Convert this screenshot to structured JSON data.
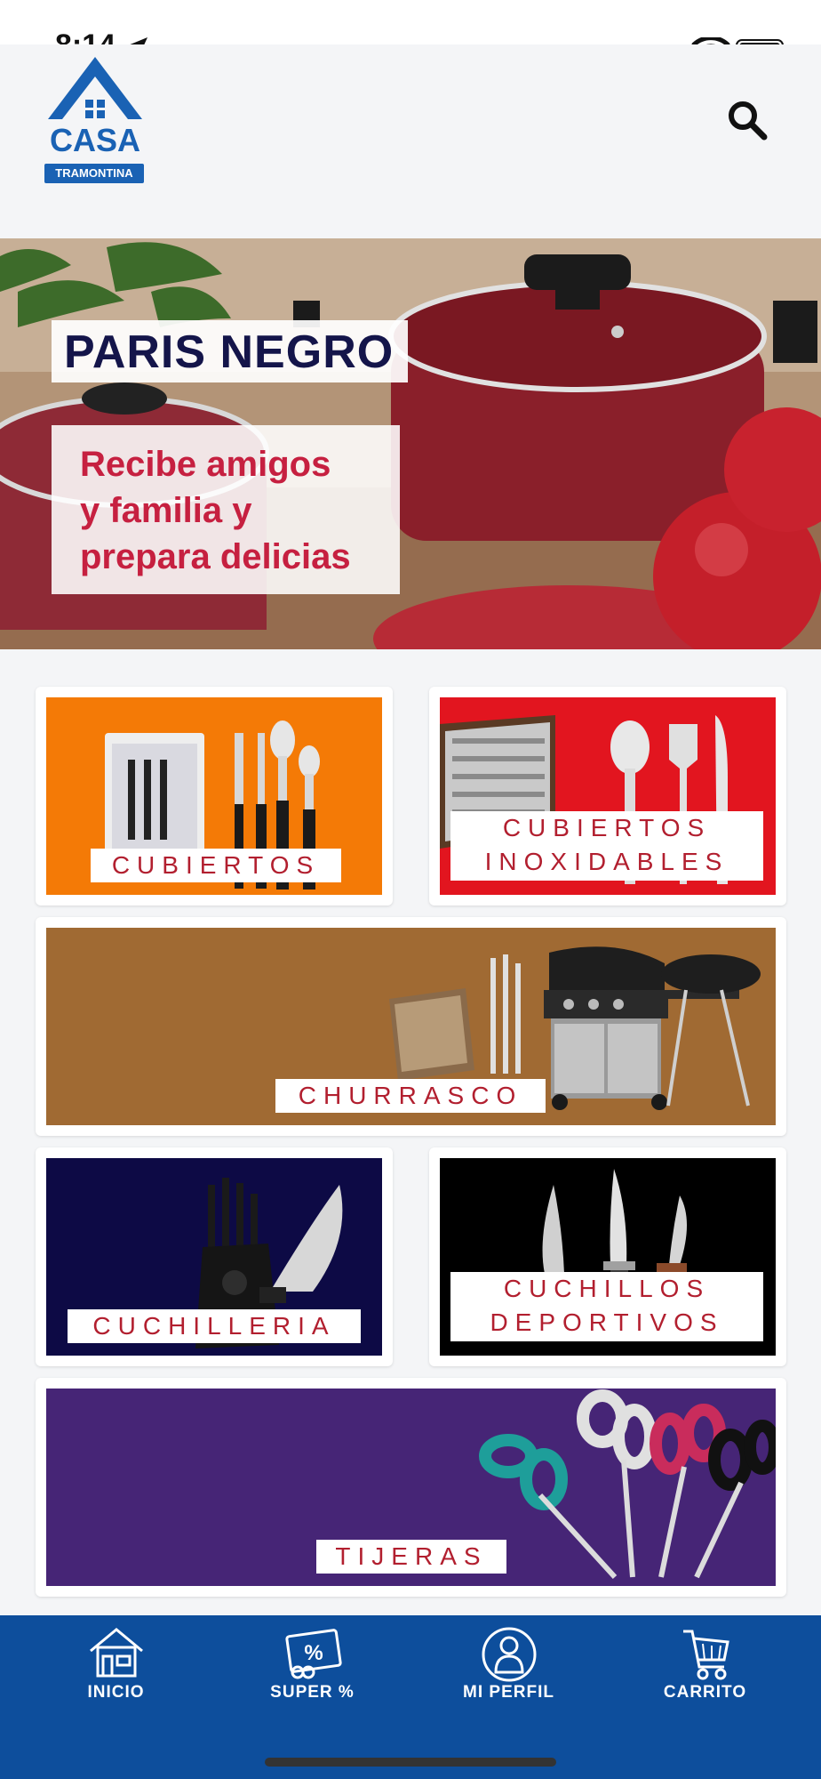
{
  "status_bar": {
    "time": "8:14"
  },
  "header": {
    "brand_name": "CASA",
    "brand_sub": "TRAMONTINA",
    "search_icon": "search-icon"
  },
  "hero": {
    "title": "PARIS NEGRO",
    "subtitle_lines": [
      "Recibe amigos",
      "y familia y",
      "prepara delicias"
    ]
  },
  "categories": [
    {
      "label": "CUBIERTOS",
      "color": "#f47a06"
    },
    {
      "label_lines": [
        "CUBIERTOS",
        "INOXIDABLES"
      ],
      "color": "#e2151f"
    },
    {
      "label": "CHURRASCO",
      "color": "#a06a33"
    },
    {
      "label": "CUCHILLERIA",
      "color": "#0d0a45"
    },
    {
      "label_lines": [
        "CUCHILLOS",
        "DEPORTIVOS"
      ],
      "color": "#000000"
    },
    {
      "label": "TIJERAS",
      "color": "#462576"
    }
  ],
  "bottom_nav": {
    "color": "#0d4e9c",
    "items": [
      {
        "label": "INICIO",
        "icon": "home-icon"
      },
      {
        "label": "SUPER %",
        "icon": "discount-icon"
      },
      {
        "label": "MI PERFIL",
        "icon": "profile-icon"
      },
      {
        "label": "CARRITO",
        "icon": "cart-icon"
      }
    ]
  }
}
